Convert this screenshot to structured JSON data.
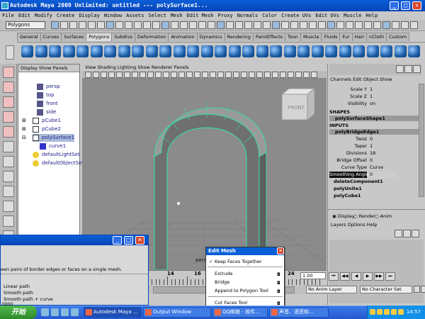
{
  "window": {
    "title": "Autodesk Maya 2009 Unlimited: untitled   ---   polySurface1..."
  },
  "menubar": [
    "File",
    "Edit",
    "Modify",
    "Create",
    "Display",
    "Window",
    "Assets",
    "Select",
    "Mesh",
    "Edit Mesh",
    "Proxy",
    "Normals",
    "Color",
    "Create UVs",
    "Edit UVs",
    "Muscle",
    "Help"
  ],
  "mode": "Polygons",
  "shelf_tabs": [
    "General",
    "Curves",
    "Surfaces",
    "Polygons",
    "Subdivs",
    "Deformation",
    "Animation",
    "Dynamics",
    "Rendering",
    "PaintEffects",
    "Toon",
    "Muscle",
    "Fluids",
    "Fur",
    "Hair",
    "nCloth",
    "Custom"
  ],
  "active_shelf": "Polygons",
  "outliner": {
    "menu": "Display  Show  Panels",
    "items": [
      "persp",
      "top",
      "front",
      "side",
      "pCube1",
      "pCube2",
      "polySurface1",
      "curve1",
      "defaultLightSet",
      "defaultObjectSet"
    ]
  },
  "viewport": {
    "menu": "View  Shading  Lighting  Show  Renderer  Panels",
    "view_cube_label": "FRONT",
    "camera": "persp"
  },
  "channels": {
    "menu": "Channels  Edit  Object  Show",
    "transform": [
      {
        "name": "Scale Y",
        "value": "1"
      },
      {
        "name": "Scale Z",
        "value": "1"
      },
      {
        "name": "Visibility",
        "value": "on"
      }
    ],
    "shapes_label": "SHAPES",
    "shape": "polySurfaceShape1",
    "inputs_label": "INPUTS",
    "node": "polyBridgeEdge1",
    "attrs": [
      {
        "name": "Twist",
        "value": "0"
      },
      {
        "name": "Taper",
        "value": "1"
      },
      {
        "name": "Divisions",
        "value": "18"
      },
      {
        "name": "Bridge Offset",
        "value": "0"
      },
      {
        "name": "Curve Type",
        "value": "Curve"
      },
      {
        "name": "Smoothing Angle",
        "value": "0"
      }
    ],
    "other_nodes": [
      "deleteComponent1",
      "polyUnite1",
      "polyCube1"
    ],
    "layer_modes": [
      "Display",
      "Render",
      "Anim"
    ],
    "layer_menu": "Layers  Options  Help"
  },
  "timeline": {
    "ticks": [
      "14",
      "16",
      "18",
      "24"
    ],
    "current": "1.00"
  },
  "range": {
    "anim_layer": "No Anim Layer",
    "char_set": "No Character Set"
  },
  "edit_mesh_menu": {
    "title": "Edit Mesh",
    "keep_faces": "Keep Faces Together",
    "items": [
      "Extrude",
      "Bridge",
      "Append to Polygon Tool",
      "Cut Faces Tool"
    ]
  },
  "output_window": {
    "help_text": "een pairs of border edges or faces on a single mesh.",
    "options": [
      "Linear path",
      "Smooth path",
      "Smooth path + curve"
    ],
    "value": "0000"
  },
  "taskbar": {
    "start": "开始",
    "tasks": [
      "Autodesk Maya ...",
      "Output Window",
      "QQ邮箱 - 收件...",
      "声音、语音和..."
    ],
    "clock": "14:57"
  }
}
